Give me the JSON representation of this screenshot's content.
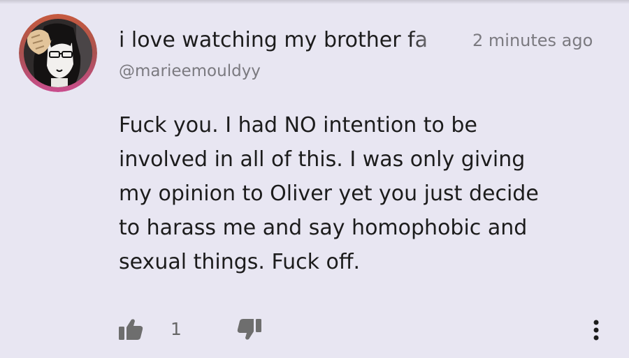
{
  "comment": {
    "author_name": "i love watching my brother fa",
    "timestamp": "2 minutes ago",
    "handle": "@marieemouldyy",
    "body_lines": [
      "Fuck you. I had NO intention to be",
      "involved in all of this. I was only giving",
      "my opinion to Oliver yet you just decide",
      "to harass me and say homophobic and",
      "sexual things. Fuck off."
    ],
    "like_count": "1"
  },
  "icons": {
    "like": "thumbs-up-icon",
    "dislike": "thumbs-down-icon",
    "more": "vertical-ellipsis-icon"
  },
  "colors": {
    "background": "#e8e6f2",
    "text": "#1c1c1c",
    "muted": "#7b7a80",
    "icon": "#6e6e6e",
    "avatar_ring_top": "#c65a3f",
    "avatar_ring_bottom": "#c94d8e"
  }
}
